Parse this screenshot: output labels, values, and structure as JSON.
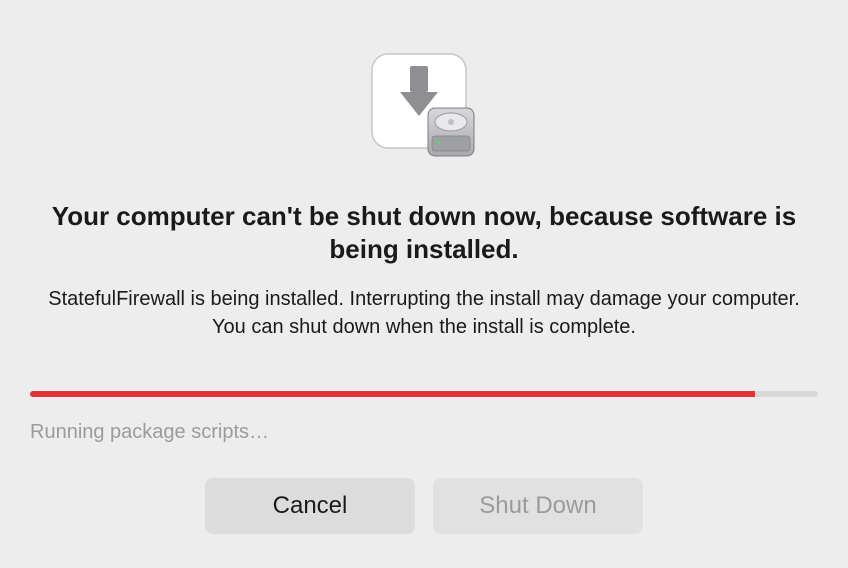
{
  "dialog": {
    "title": "Your computer can't be shut down now, because software is being installed.",
    "subtitle": "StatefulFirewall is being installed. Interrupting the install may damage your computer. You can shut down when the install is complete.",
    "status": "Running package scripts…",
    "progress_percent": 92
  },
  "buttons": {
    "cancel": "Cancel",
    "shutdown": "Shut Down"
  },
  "icon": {
    "name": "installer-package-icon"
  },
  "colors": {
    "background": "#ededee",
    "progress_fill": "#e03436"
  }
}
